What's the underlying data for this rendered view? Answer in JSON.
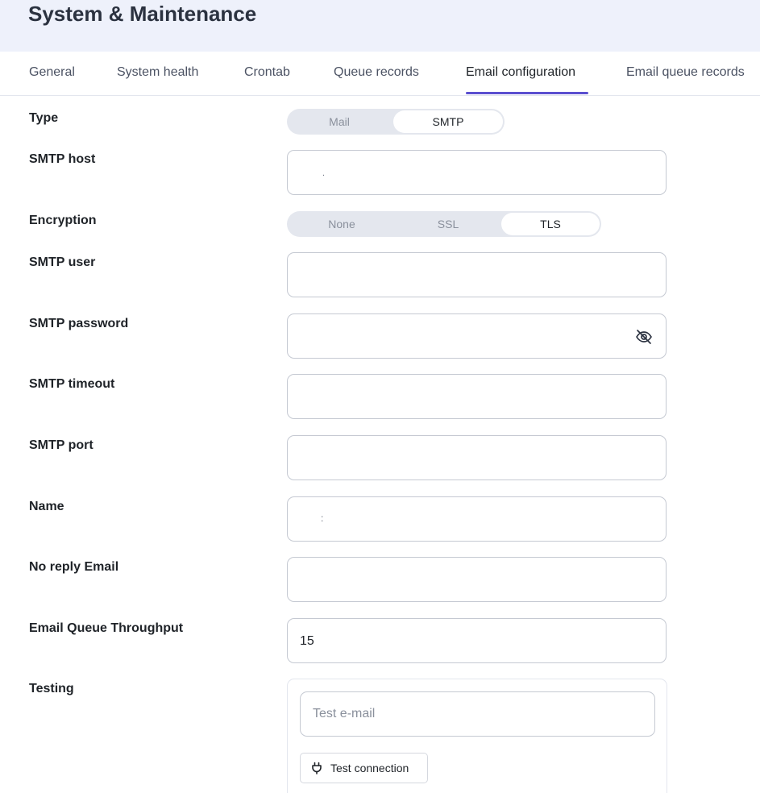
{
  "header": {
    "title": "System & Maintenance"
  },
  "tabs": [
    {
      "label": "General",
      "active": false
    },
    {
      "label": "System health",
      "active": false
    },
    {
      "label": "Crontab",
      "active": false
    },
    {
      "label": "Queue records",
      "active": false
    },
    {
      "label": "Email configuration",
      "active": true
    },
    {
      "label": "Email queue records",
      "active": false
    }
  ],
  "accent_color": "#5b4fcf",
  "form": {
    "type": {
      "label": "Type",
      "options": [
        "Mail",
        "SMTP"
      ],
      "selected": "SMTP"
    },
    "smtp_host": {
      "label": "SMTP host",
      "value": "."
    },
    "encryption": {
      "label": "Encryption",
      "options": [
        "None",
        "SSL",
        "TLS"
      ],
      "selected": "TLS"
    },
    "smtp_user": {
      "label": "SMTP user",
      "value": ""
    },
    "smtp_password": {
      "label": "SMTP password",
      "value": "",
      "icon": "eye-off-icon"
    },
    "smtp_timeout": {
      "label": "SMTP timeout",
      "value": ""
    },
    "smtp_port": {
      "label": "SMTP port",
      "value": ""
    },
    "name": {
      "label": "Name",
      "value": ":"
    },
    "no_reply_email": {
      "label": "No reply Email",
      "value": ""
    },
    "queue_throughput": {
      "label": "Email Queue Throughput",
      "value": "15"
    },
    "testing": {
      "label": "Testing",
      "input_placeholder": "Test e-mail",
      "button_label": "Test connection",
      "button_icon": "plug-icon"
    }
  }
}
